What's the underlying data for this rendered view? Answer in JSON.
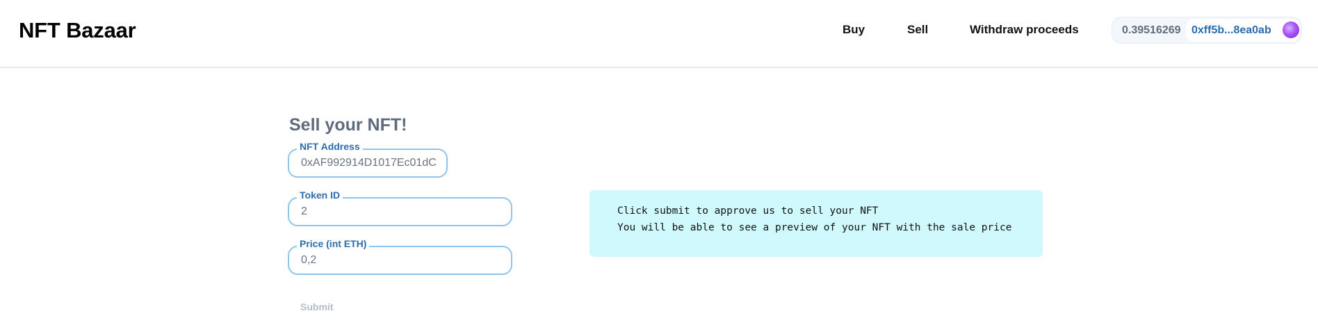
{
  "header": {
    "logo": "NFT Bazaar",
    "nav": [
      {
        "label": "Buy"
      },
      {
        "label": "Sell"
      },
      {
        "label": "Withdraw proceeds"
      }
    ],
    "wallet": {
      "balance": "0.39516269",
      "address": "0xff5b...8ea0ab",
      "avatar_icon": "avatar-icon"
    }
  },
  "form": {
    "title": "Sell your NFT!",
    "fields": [
      {
        "label": "NFT Address",
        "value": "0xAF992914D1017Ec01dC"
      },
      {
        "label": "Token ID",
        "value": "2"
      },
      {
        "label": "Price (int ETH)",
        "value": "0,2"
      }
    ],
    "submit_label": "Submit"
  },
  "info": {
    "lines": [
      "Click submit to approve us to sell your NFT",
      "You will be able to see a preview of your NFT with the sale price"
    ],
    "background": "#cff9fc"
  },
  "colors": {
    "accent": "#2b6cb0",
    "field_border": "#8ec5e8",
    "muted_text": "#5f6b7c"
  }
}
